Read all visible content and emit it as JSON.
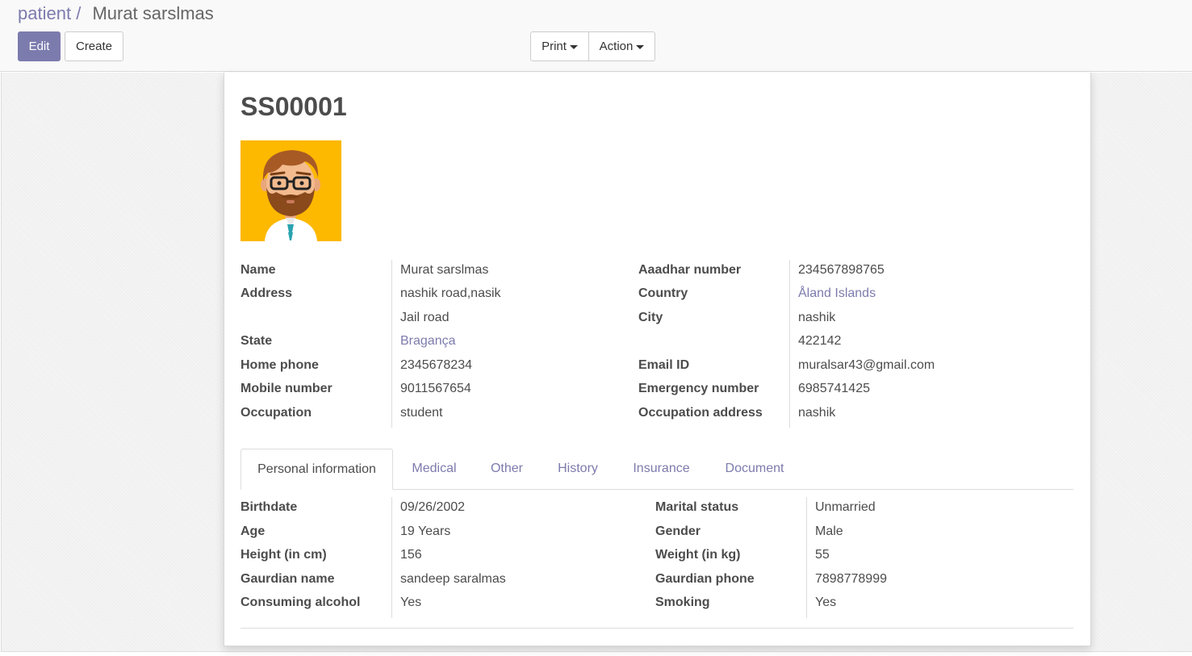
{
  "breadcrumb": {
    "parent": "patient",
    "separator": "/",
    "current": "Murat sarslmas"
  },
  "toolbar": {
    "edit": "Edit",
    "create": "Create",
    "print": "Print",
    "action": "Action"
  },
  "record": {
    "reference": "SS00001",
    "avatar_icon": "man-with-beard-glasses-avatar-icon"
  },
  "fields": {
    "name_label": "Name",
    "name": "Murat sarslmas",
    "address_label": "Address",
    "address1": "nashik road,nasik",
    "address2": "Jail road",
    "state_label": "State",
    "state": "Bragança",
    "home_phone_label": "Home phone",
    "home_phone": "2345678234",
    "mobile_label": "Mobile number",
    "mobile": "9011567654",
    "occupation_label": "Occupation",
    "occupation": "student",
    "aadhar_label": "Aaadhar number",
    "aadhar": "234567898765",
    "country_label": "Country",
    "country": "Åland Islands",
    "city_label": "City",
    "city": "nashik",
    "zip": "422142",
    "email_label": "Email ID",
    "email": "muralsar43@gmail.com",
    "emergency_label": "Emergency number",
    "emergency": "6985741425",
    "occ_address_label": "Occupation address",
    "occ_address": "nashik"
  },
  "tabs": [
    "Personal information",
    "Medical",
    "Other",
    "History",
    "Insurance",
    "Document"
  ],
  "personal": {
    "birthdate_label": "Birthdate",
    "birthdate": "09/26/2002",
    "age_label": "Age",
    "age": "19 Years",
    "height_label": "Height (in cm)",
    "height": "156",
    "guardian_name_label": "Gaurdian name",
    "guardian_name": "sandeep saralmas",
    "alcohol_label": "Consuming alcohol",
    "alcohol": "Yes",
    "marital_label": "Marital status",
    "marital": "Unmarried",
    "gender_label": "Gender",
    "gender": "Male",
    "weight_label": "Weight (in kg)",
    "weight": "55",
    "guardian_phone_label": "Gaurdian phone",
    "guardian_phone": "7898778999",
    "smoking_label": "Smoking",
    "smoking": "Yes"
  },
  "colors": {
    "accent": "#7c7bad",
    "text": "#4c4c4c",
    "avatar_bg": "#fdb800"
  }
}
